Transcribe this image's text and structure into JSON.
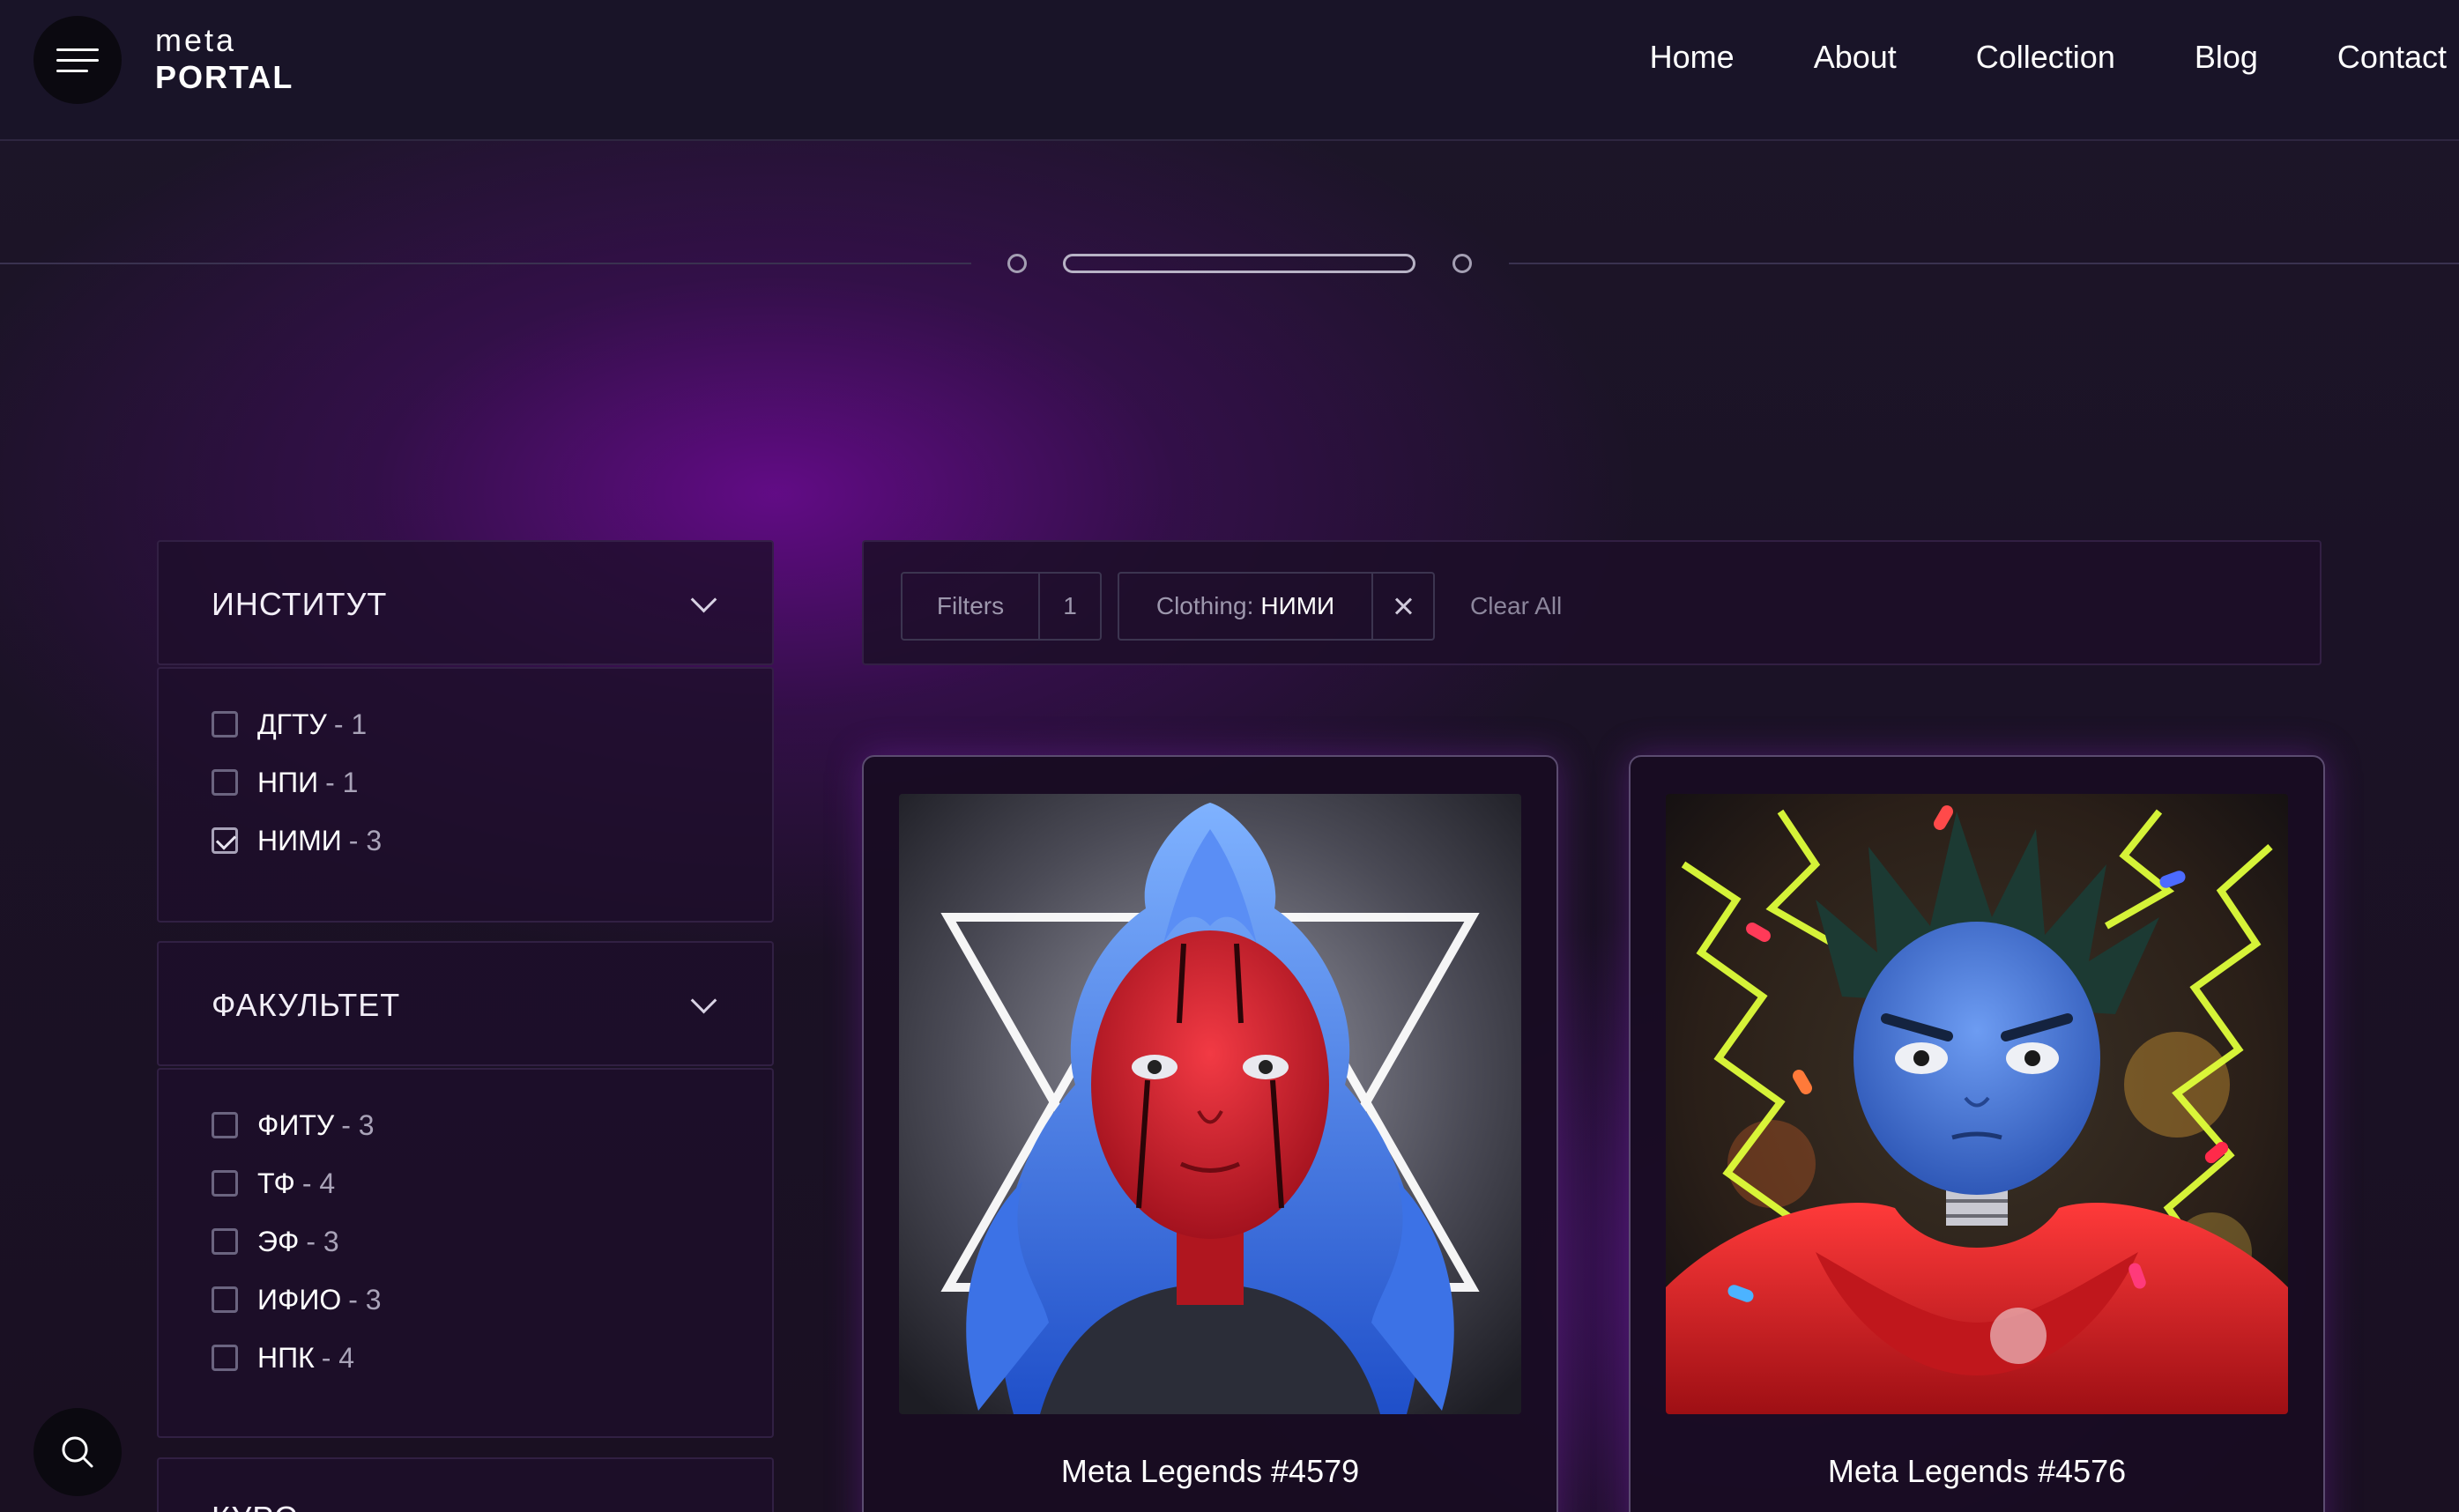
{
  "header": {
    "logo_top": "meta",
    "logo_bottom": "PORTAL",
    "nav": [
      "Home",
      "About",
      "Collection",
      "Blog",
      "Contact"
    ]
  },
  "sidebar": {
    "groups": [
      {
        "title": "ИНСТИТУТ",
        "options": [
          {
            "name": "ДГТУ",
            "count": "- 1",
            "checked": false
          },
          {
            "name": "НПИ",
            "count": "- 1",
            "checked": false
          },
          {
            "name": "НИМИ",
            "count": "- 3",
            "checked": true
          }
        ]
      },
      {
        "title": "ФАКУЛЬТЕТ",
        "options": [
          {
            "name": "ФИТУ",
            "count": "- 3",
            "checked": false
          },
          {
            "name": "ТФ",
            "count": "- 4",
            "checked": false
          },
          {
            "name": "ЭФ",
            "count": "- 3",
            "checked": false
          },
          {
            "name": "ИФИО",
            "count": "- 3",
            "checked": false
          },
          {
            "name": "НПК",
            "count": "- 4",
            "checked": false
          }
        ]
      },
      {
        "title": "КУРС"
      }
    ]
  },
  "filters": {
    "label": "Filters",
    "count": "1",
    "active_key": "Clothing:",
    "active_value": "НИМИ",
    "clear_label": "Clear All"
  },
  "cards": [
    {
      "title": "Meta Legends #4579"
    },
    {
      "title": "Meta Legends #4576"
    }
  ],
  "icons": {
    "menu": "hamburger-icon",
    "search": "search-icon",
    "chevron": "chevron-down-icon",
    "close": "close-icon"
  }
}
